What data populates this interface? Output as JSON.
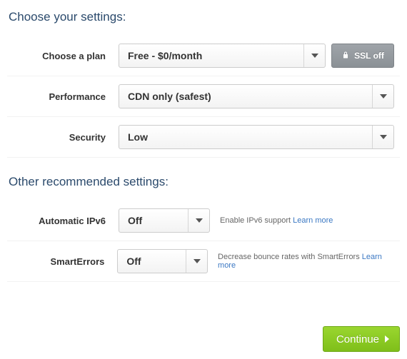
{
  "headings": {
    "main": "Choose your settings:",
    "other": "Other recommended settings:"
  },
  "rows": {
    "plan": {
      "label": "Choose a plan",
      "value": "Free - $0/month"
    },
    "performance": {
      "label": "Performance",
      "value": "CDN only (safest)"
    },
    "security": {
      "label": "Security",
      "value": "Low"
    },
    "ipv6": {
      "label": "Automatic IPv6",
      "value": "Off",
      "help": "Enable IPv6 support ",
      "link": "Learn more"
    },
    "smarterrors": {
      "label": "SmartErrors",
      "value": "Off",
      "help": "Decrease bounce rates with SmartErrors ",
      "link": "Learn more"
    }
  },
  "buttons": {
    "ssl": "SSL off",
    "continue": "Continue"
  }
}
